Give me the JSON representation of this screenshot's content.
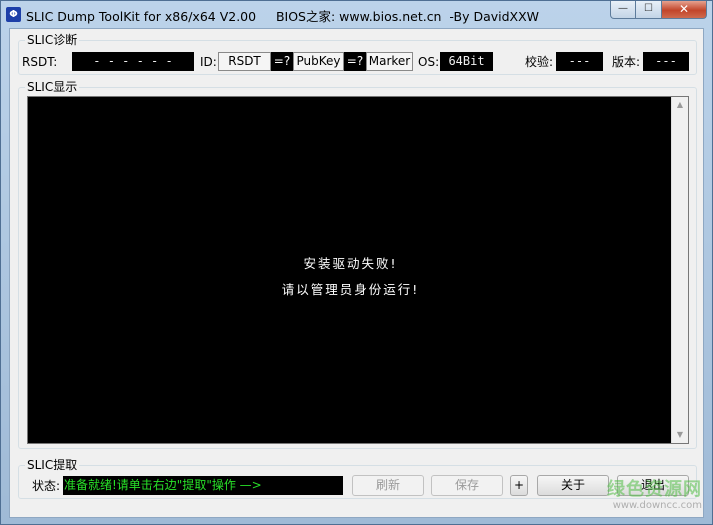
{
  "window": {
    "title": "SLIC Dump ToolKit for x86/x64 V2.00     BIOS之家: www.bios.net.cn  -By DavidXXW",
    "icon_glyph": "Φ",
    "minimize_glyph": "—",
    "maximize_glyph": "☐",
    "close_glyph": "✕"
  },
  "diag": {
    "group_title": "SLIC诊断",
    "rsdt_label": "RSDT:",
    "rsdt_value": "- - - - - -",
    "id_label": "ID:",
    "id_value": "RSDT",
    "eq1": "=?",
    "pubkey_value": "PubKey",
    "eq2": "=?",
    "marker_value": "Marker",
    "os_label": "OS:",
    "os_value": "64Bit",
    "checksum_label": "校验:",
    "checksum_value": "---",
    "version_label": "版本:",
    "version_value": "---"
  },
  "show": {
    "group_title": "SLIC显示",
    "line1": "安装驱动失败!",
    "line2": "请以管理员身份运行!",
    "scroll_up": "▲",
    "scroll_down": "▼"
  },
  "take": {
    "group_title": "SLIC提取",
    "status_label": "状态:",
    "status_text": "准备就绪!请单击右边\"提取\"操作  —>",
    "refresh_label": "刷新",
    "save_label": "保存",
    "plus_label": "+",
    "about_label": "关于",
    "exit_label": "退出"
  },
  "watermark": {
    "main": "绿色资源网",
    "sub": "www.downcc.com"
  }
}
